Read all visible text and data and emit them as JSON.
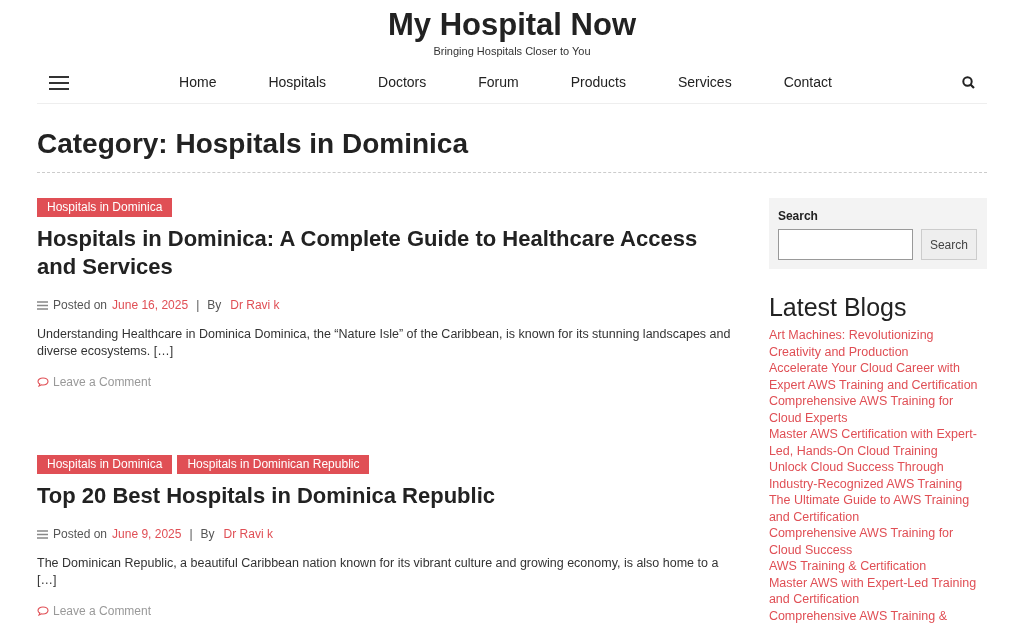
{
  "site": {
    "title": "My Hospital Now",
    "tagline": "Bringing Hospitals Closer to You"
  },
  "nav": {
    "items": [
      {
        "label": "Home"
      },
      {
        "label": "Hospitals"
      },
      {
        "label": "Doctors"
      },
      {
        "label": "Forum"
      },
      {
        "label": "Products"
      },
      {
        "label": "Services"
      },
      {
        "label": "Contact"
      }
    ]
  },
  "page_title": "Category: Hospitals in Dominica",
  "posts": [
    {
      "tags": [
        "Hospitals in Dominica"
      ],
      "title": "Hospitals in Dominica: A Complete Guide to Healthcare Access and Services",
      "posted_label": "Posted on",
      "date": "June 16, 2025",
      "separator": "|",
      "by_label": "By",
      "author": "Dr Ravi k",
      "excerpt": "Understanding Healthcare in Dominica Dominica, the “Nature Isle” of the Caribbean, is known for its stunning landscapes and diverse ecosystems. […]",
      "comment_link": "Leave a Comment"
    },
    {
      "tags": [
        "Hospitals in Dominica",
        "Hospitals in Dominican Republic"
      ],
      "title": "Top 20 Best Hospitals in Dominica Republic",
      "posted_label": "Posted on",
      "date": "June 9, 2025",
      "separator": "|",
      "by_label": "By",
      "author": "Dr Ravi k",
      "excerpt": "The Dominican Republic, a beautiful Caribbean nation known for its vibrant culture and growing economy, is also home to a […]",
      "comment_link": "Leave a Comment"
    }
  ],
  "sidebar": {
    "search": {
      "label": "Search",
      "button": "Search"
    },
    "latest_blogs": {
      "title": "Latest Blogs",
      "items": [
        "Art Machines: Revolutionizing Creativity and Production",
        "Accelerate Your Cloud Career with Expert AWS Training and Certification",
        "Comprehensive AWS Training for Cloud Experts",
        "Master AWS Certification with Expert-Led, Hands-On Cloud Training",
        "Unlock Cloud Success Through Industry-Recognized AWS Training",
        "The Ultimate Guide to AWS Training and Certification",
        "Comprehensive AWS Training for Cloud Success",
        "AWS Training & Certification",
        "Master AWS with Expert-Led Training and Certification",
        "Comprehensive AWS Training &"
      ]
    }
  }
}
